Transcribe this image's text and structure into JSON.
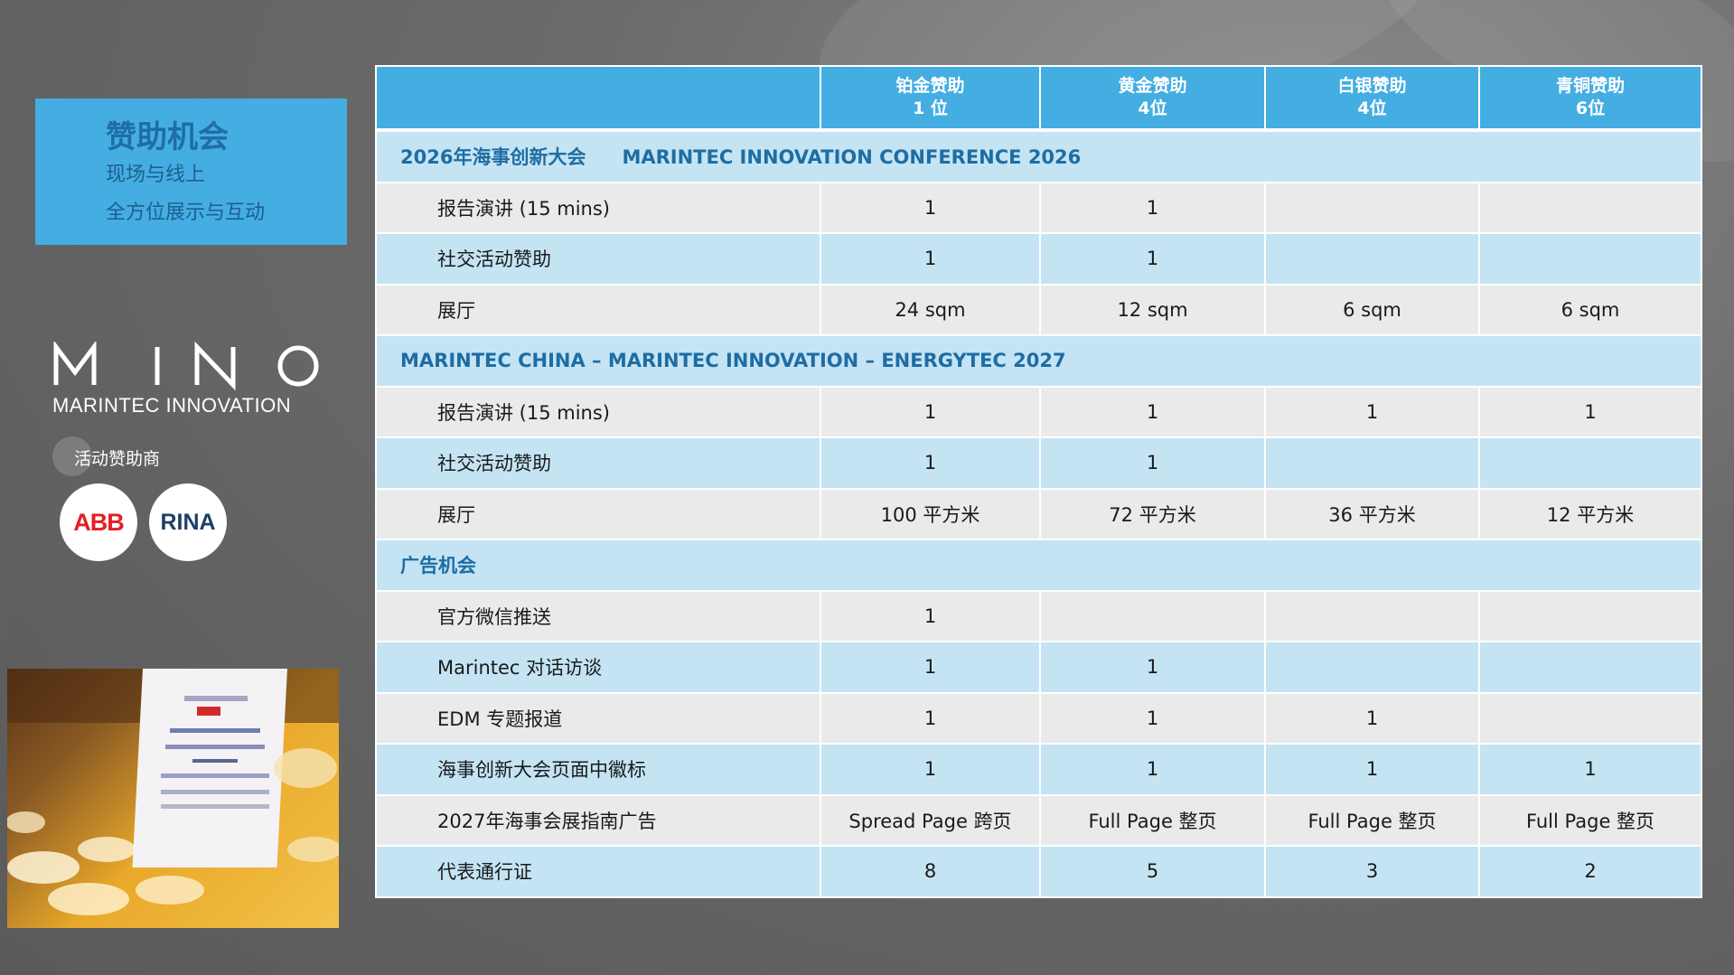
{
  "sidebar": {
    "title": "赞助机会",
    "subtitle1": "现场与线上",
    "subtitle2": "全方位展示与互动",
    "brand_logo": "M I N O",
    "brand_sub": "MARINTEC INNOVATION",
    "sponsor_label": "活动赞助商",
    "sponsor_logos": [
      "ABB",
      "RINA"
    ]
  },
  "colors": {
    "accent": "#44ade2",
    "section_bg": "#c4e4f4",
    "section_text": "#1e6da3",
    "row_grey": "#eaeaea"
  },
  "table": {
    "headers": [
      {
        "line1": "",
        "line2": ""
      },
      {
        "line1": "铂金赞助",
        "line2": "1 位"
      },
      {
        "line1": "黄金赞助",
        "line2": "4位"
      },
      {
        "line1": "白银赞助",
        "line2": "4位"
      },
      {
        "line1": "青铜赞助",
        "line2": "6位"
      }
    ],
    "sections": [
      {
        "title_cn": "2026年海事创新大会",
        "title_en": "MARINTEC INNOVATION CONFERENCE 2026",
        "rows": [
          {
            "label": "报告演讲 (15 mins)",
            "values": [
              "1",
              "1",
              "",
              ""
            ]
          },
          {
            "label": "社交活动赞助",
            "values": [
              "1",
              "1",
              "",
              ""
            ]
          },
          {
            "label": "展厅",
            "values": [
              "24 sqm",
              "12 sqm",
              "6 sqm",
              "6 sqm"
            ]
          }
        ]
      },
      {
        "title_cn": "",
        "title_en": "MARINTEC CHINA – MARINTEC INNOVATION – ENERGYTEC 2027",
        "rows": [
          {
            "label": "报告演讲 (15 mins)",
            "values": [
              "1",
              "1",
              "1",
              "1"
            ]
          },
          {
            "label": "社交活动赞助",
            "values": [
              "1",
              "1",
              "",
              ""
            ]
          },
          {
            "label": "展厅",
            "values": [
              "100 平方米",
              "72 平方米",
              "36 平方米",
              "12 平方米"
            ]
          }
        ]
      },
      {
        "title_cn": "广告机会",
        "title_en": "",
        "rows": [
          {
            "label": "官方微信推送",
            "values": [
              "1",
              "",
              "",
              ""
            ]
          },
          {
            "label": "Marintec 对话访谈",
            "values": [
              "1",
              "1",
              "",
              ""
            ]
          },
          {
            "label": "EDM 专题报道",
            "values": [
              "1",
              "1",
              "1",
              ""
            ]
          },
          {
            "label": "海事创新大会页面中徽标",
            "values": [
              "1",
              "1",
              "1",
              "1"
            ]
          },
          {
            "label": "2027年海事会展指南广告",
            "values": [
              "Spread Page 跨页",
              "Full Page 整页",
              "Full Page 整页",
              "Full Page 整页"
            ]
          },
          {
            "label": "代表通行证",
            "values": [
              "8",
              "5",
              "3",
              "2"
            ]
          }
        ]
      }
    ]
  }
}
